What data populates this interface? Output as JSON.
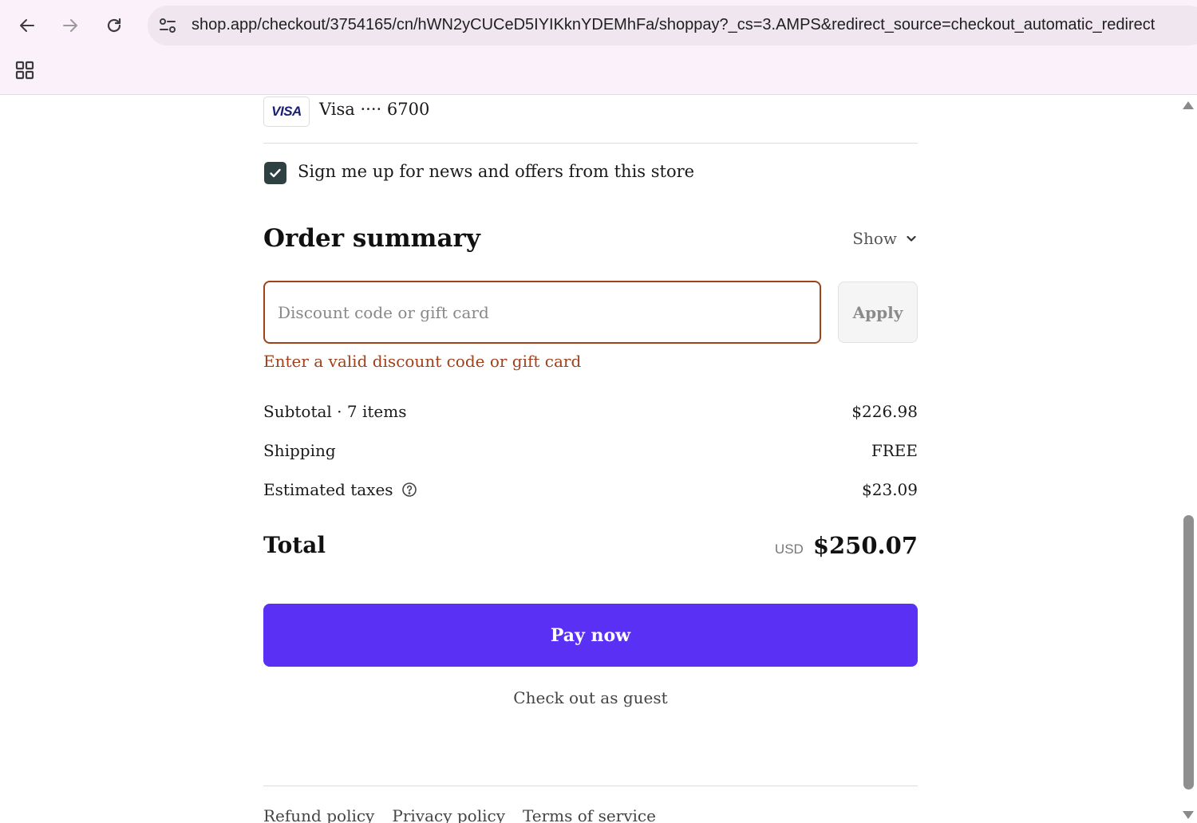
{
  "browser": {
    "url": "shop.app/checkout/3754165/cn/hWN2yCUCeD5IYIKknYDEMhFa/shoppay?_cs=3.AMPS&redirect_source=checkout_automatic_redirect"
  },
  "payment": {
    "card_brand": "VISA",
    "card_text": "Visa ···· 6700"
  },
  "newsletter": {
    "label": "Sign me up for news and offers from this store",
    "checked": true
  },
  "order_summary": {
    "title": "Order summary",
    "toggle_label": "Show",
    "discount_placeholder": "Discount code or gift card",
    "apply_label": "Apply",
    "error_text": "Enter a valid discount code or gift card",
    "subtotal_label": "Subtotal · 7 items",
    "subtotal_value": "$226.98",
    "shipping_label": "Shipping",
    "shipping_value": "FREE",
    "taxes_label": "Estimated taxes",
    "taxes_value": "$23.09",
    "total_label": "Total",
    "currency": "USD",
    "total_value": "$250.07"
  },
  "actions": {
    "pay_label": "Pay now",
    "guest_label": "Check out as guest"
  },
  "footer": {
    "links": [
      "Refund policy",
      "Privacy policy",
      "Terms of service"
    ]
  },
  "colors": {
    "pay_button": "#5a31f4",
    "error": "#a0411c",
    "checkbox": "#2f4042"
  }
}
